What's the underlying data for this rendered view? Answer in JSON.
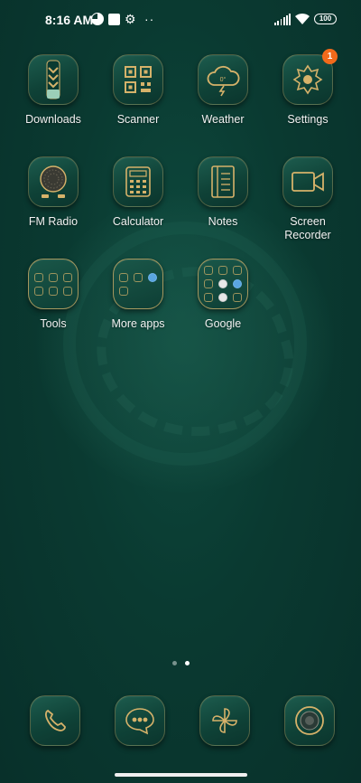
{
  "status_bar": {
    "time": "8:16 AM",
    "icons": [
      "data-saver-icon",
      "screenshot-square-icon",
      "gear-icon",
      "more-dots-icon",
      "signal-icon",
      "wifi-icon",
      "battery-icon"
    ],
    "battery": "100"
  },
  "apps": [
    {
      "id": "downloads",
      "label": "Downloads",
      "icon": "downloads-icon"
    },
    {
      "id": "scanner",
      "label": "Scanner",
      "icon": "qr-scanner-icon"
    },
    {
      "id": "weather",
      "label": "Weather",
      "icon": "weather-cloud-icon",
      "temp": "0°"
    },
    {
      "id": "settings",
      "label": "Settings",
      "icon": "settings-gear-icon",
      "badge": "1"
    },
    {
      "id": "fm-radio",
      "label": "FM Radio",
      "icon": "radio-icon"
    },
    {
      "id": "calculator",
      "label": "Calculator",
      "icon": "calculator-icon"
    },
    {
      "id": "notes",
      "label": "Notes",
      "icon": "notes-icon"
    },
    {
      "id": "screen-recorder",
      "label": "Screen\nRecorder",
      "icon": "video-camera-icon"
    }
  ],
  "folders": [
    {
      "id": "tools",
      "label": "Tools",
      "icon": "folder-icon"
    },
    {
      "id": "more-apps",
      "label": "More apps",
      "icon": "folder-icon"
    },
    {
      "id": "google",
      "label": "Google",
      "icon": "folder-icon"
    }
  ],
  "page_indicator": {
    "count": 2,
    "active": 2
  },
  "dock": [
    {
      "id": "phone",
      "icon": "phone-icon"
    },
    {
      "id": "messages",
      "icon": "message-bubble-icon"
    },
    {
      "id": "gallery",
      "icon": "pinwheel-icon"
    },
    {
      "id": "camera",
      "icon": "camera-lens-icon"
    }
  ],
  "colors": {
    "background": "#0a3a31",
    "accent_gold": "#d6b26a",
    "badge": "#f26a1b"
  }
}
